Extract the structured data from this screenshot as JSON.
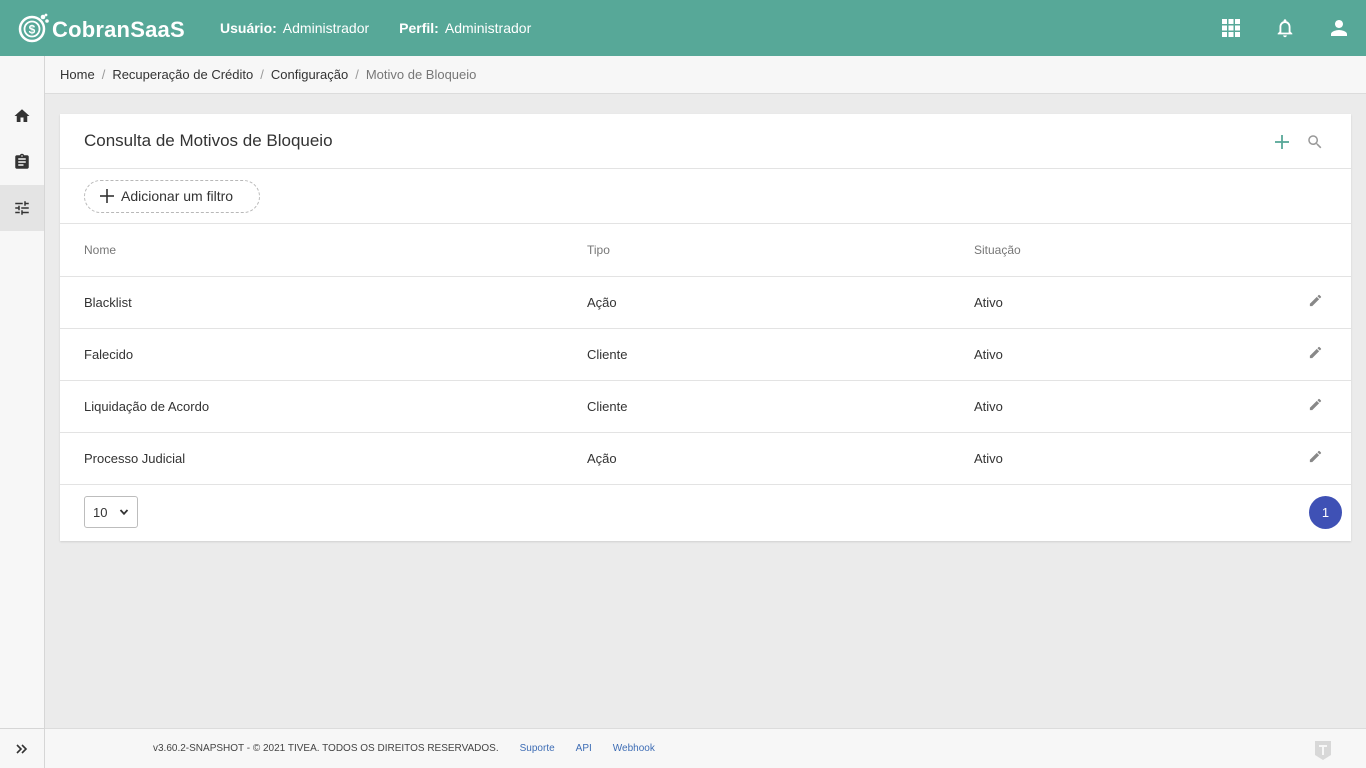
{
  "app": {
    "logo_text": "CobranSaaS",
    "brand_color": "#57a898",
    "accent_color": "#3f51b5"
  },
  "header": {
    "user_label": "Usuário:",
    "user_value": "Administrador",
    "profile_label": "Perfil:",
    "profile_value": "Administrador",
    "icons": [
      "apps-grid-icon",
      "bell-icon",
      "user-icon"
    ]
  },
  "sidebar": {
    "items": [
      {
        "icon": "home-icon",
        "active": false
      },
      {
        "icon": "clipboard-icon",
        "active": false
      },
      {
        "icon": "sliders-icon",
        "active": true
      }
    ],
    "expand_icon": "double-chevron-right-icon"
  },
  "breadcrumb": {
    "items": [
      "Home",
      "Recuperação de Crédito",
      "Configuração"
    ],
    "current": "Motivo de Bloqueio"
  },
  "card": {
    "title": "Consulta de Motivos de Bloqueio",
    "actions": [
      "plus-icon",
      "search-icon"
    ],
    "filter_button": "Adicionar um filtro"
  },
  "table": {
    "columns": [
      "Nome",
      "Tipo",
      "Situação"
    ],
    "rows": [
      {
        "nome": "Blacklist",
        "tipo": "Ação",
        "situacao": "Ativo"
      },
      {
        "nome": "Falecido",
        "tipo": "Cliente",
        "situacao": "Ativo"
      },
      {
        "nome": "Liquidação de Acordo",
        "tipo": "Cliente",
        "situacao": "Ativo"
      },
      {
        "nome": "Processo Judicial",
        "tipo": "Ação",
        "situacao": "Ativo"
      }
    ]
  },
  "pagination": {
    "page_size": "10",
    "current_page": "1"
  },
  "footer": {
    "copyright": "v3.60.2-SNAPSHOT - © 2021 TIVEA. TODOS OS DIREITOS RESERVADOS.",
    "links": [
      "Suporte",
      "API",
      "Webhook"
    ]
  }
}
